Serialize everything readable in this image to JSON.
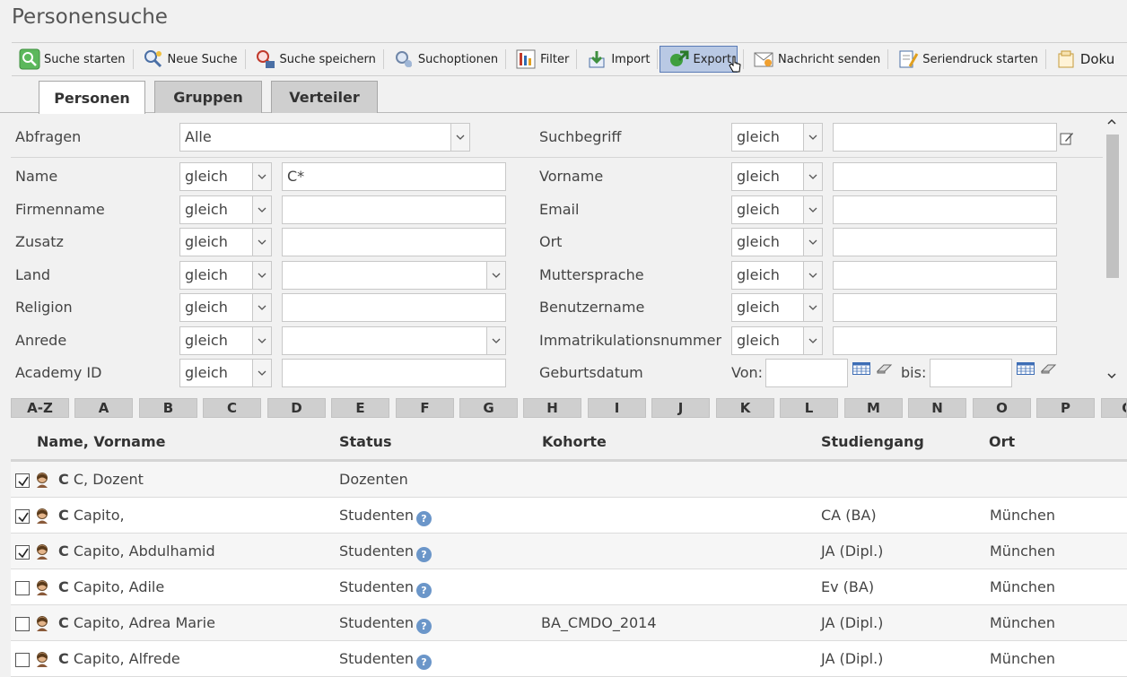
{
  "title": "Personensuche",
  "toolbar": [
    {
      "name": "suche-starten-button",
      "icon": "search-start-icon",
      "label": "Suche starten"
    },
    {
      "name": "neue-suche-button",
      "icon": "new-search-icon",
      "label": "Neue Suche"
    },
    {
      "name": "suche-speichern-button",
      "icon": "save-search-icon",
      "label": "Suche speichern"
    },
    {
      "name": "suchoptionen-button",
      "icon": "search-options-icon",
      "label": "Suchoptionen"
    },
    {
      "name": "filter-button",
      "icon": "filter-icon",
      "label": "Filter"
    },
    {
      "name": "import-button",
      "icon": "import-icon",
      "label": "Import"
    },
    {
      "name": "export-button",
      "icon": "export-icon",
      "label": "Export"
    },
    {
      "name": "nachricht-senden-button",
      "icon": "message-icon",
      "label": "Nachricht senden"
    },
    {
      "name": "seriendruck-button",
      "icon": "mail-merge-icon",
      "label": "Seriendruck starten"
    },
    {
      "name": "dokumente-button",
      "icon": "document-icon",
      "label": "Doku"
    }
  ],
  "tabs": [
    "Personen",
    "Gruppen",
    "Verteiler"
  ],
  "form": {
    "abfragen_label": "Abfragen",
    "abfragen_value": "Alle",
    "suchbegriff_label": "Suchbegriff",
    "op": "gleich",
    "name_label": "Name",
    "name_value": "C*",
    "vorname_label": "Vorname",
    "firmenname_label": "Firmenname",
    "email_label": "Email",
    "zusatz_label": "Zusatz",
    "ort_label": "Ort",
    "land_label": "Land",
    "muttersprache_label": "Muttersprache",
    "religion_label": "Religion",
    "benutzername_label": "Benutzername",
    "anrede_label": "Anrede",
    "immatrikulation_label": "Immatrikulationsnummer",
    "academy_label": "Academy ID",
    "geburtsdatum_label": "Geburtsdatum",
    "von_label": "Von:",
    "bis_label": "bis:"
  },
  "alphabet": [
    "A-Z",
    "A",
    "B",
    "C",
    "D",
    "E",
    "F",
    "G",
    "H",
    "I",
    "J",
    "K",
    "L",
    "M",
    "N",
    "O",
    "P",
    "Q"
  ],
  "table": {
    "headers": [
      "Name, Vorname",
      "Status",
      "Kohorte",
      "Studiengang",
      "Ort"
    ],
    "rows": [
      {
        "checked": true,
        "prefix": "C",
        "name": "C, Dozent",
        "status": "Dozenten",
        "info": false,
        "kohorte": "",
        "studiengang": "",
        "ort": ""
      },
      {
        "checked": true,
        "prefix": "C",
        "name": "Capito,",
        "status": "Studenten",
        "info": true,
        "kohorte": "",
        "studiengang": "CA (BA)",
        "ort": "München"
      },
      {
        "checked": true,
        "prefix": "C",
        "name": "Capito, Abdulhamid",
        "status": "Studenten",
        "info": true,
        "kohorte": "",
        "studiengang": "JA (Dipl.)",
        "ort": "München"
      },
      {
        "checked": false,
        "prefix": "C",
        "name": "Capito, Adile",
        "status": "Studenten",
        "info": true,
        "kohorte": "",
        "studiengang": "Ev (BA)",
        "ort": "München"
      },
      {
        "checked": false,
        "prefix": "C",
        "name": "Capito, Adrea Marie",
        "status": "Studenten",
        "info": true,
        "kohorte": "BA_CMDO_2014",
        "studiengang": "JA (Dipl.)",
        "ort": "München"
      },
      {
        "checked": false,
        "prefix": "C",
        "name": "Capito, Alfrede",
        "status": "Studenten",
        "info": true,
        "kohorte": "",
        "studiengang": "JA (Dipl.)",
        "ort": "München"
      }
    ]
  },
  "info_glyph": "?",
  "colors": {
    "active_button": "#b9c9e4",
    "info": "#6b96c9"
  }
}
